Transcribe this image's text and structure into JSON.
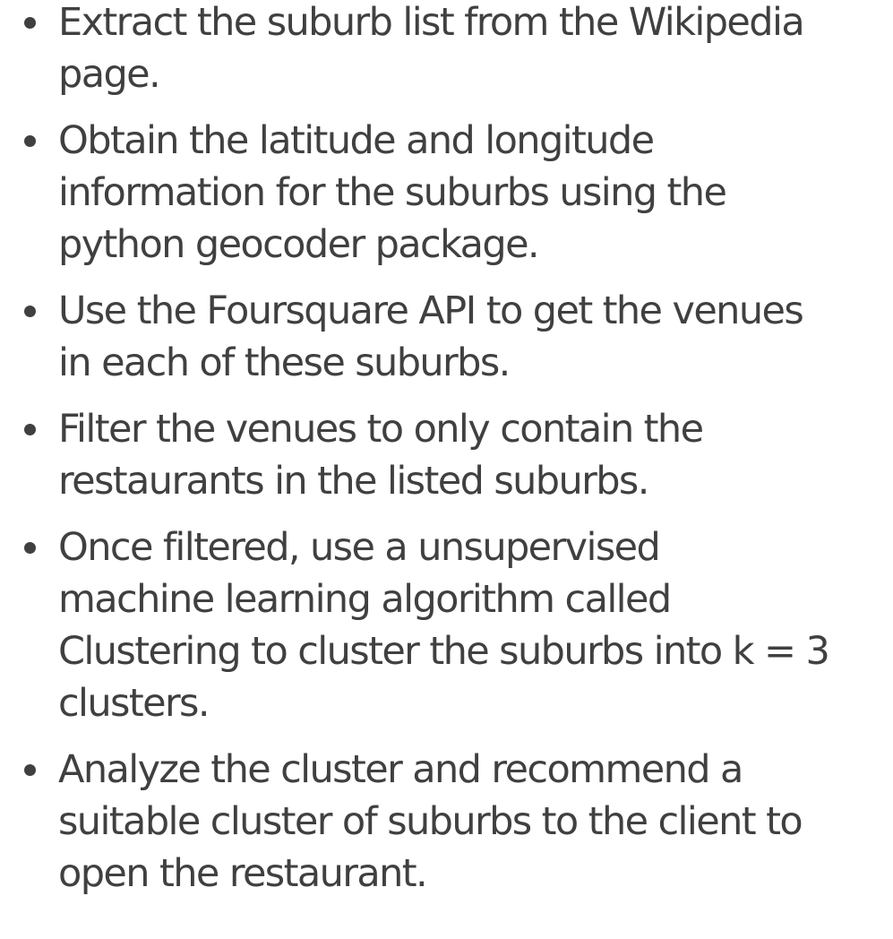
{
  "bullets": [
    {
      "lines": [
        "Extract the suburb list from the Wikipedia",
        "page."
      ]
    },
    {
      "lines": [
        "Obtain the latitude and longitude",
        "information for the suburbs using the",
        "python geocoder package."
      ]
    },
    {
      "lines": [
        "Use the Foursquare API to get the venues",
        "in each of these suburbs."
      ]
    },
    {
      "lines": [
        "Filter the venues to only contain the",
        "restaurants in the listed suburbs."
      ]
    },
    {
      "lines": [
        "Once filtered, use a unsupervised",
        "machine learning algorithm called",
        "Clustering to cluster the suburbs into k = 3",
        "clusters."
      ]
    },
    {
      "lines": [
        "Analyze the cluster and recommend a",
        "suitable cluster of suburbs to the client to",
        "open the restaurant."
      ]
    }
  ],
  "colors": {
    "text": "#404040",
    "background": "#ffffff"
  },
  "icons": {
    "bullet": "bullet-dot-icon"
  }
}
